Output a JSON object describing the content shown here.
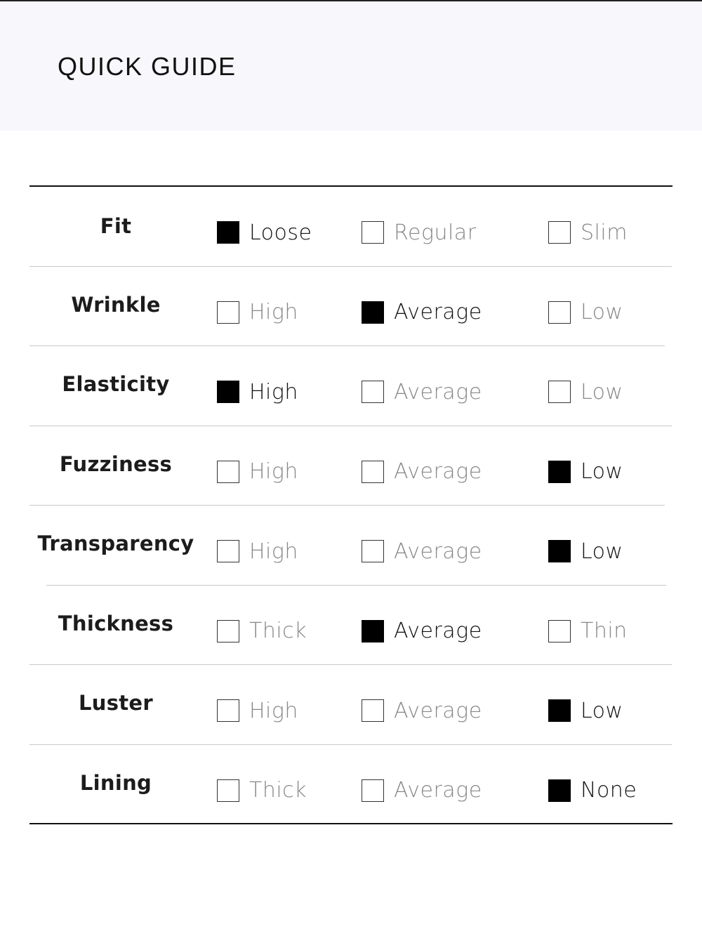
{
  "header": {
    "title": "QUICK GUIDE"
  },
  "guide": {
    "rows": [
      {
        "label": "Fit",
        "options": [
          {
            "text": "Loose",
            "selected": true
          },
          {
            "text": "Regular",
            "selected": false
          },
          {
            "text": "Slim",
            "selected": false
          }
        ]
      },
      {
        "label": "Wrinkle",
        "options": [
          {
            "text": "High",
            "selected": false
          },
          {
            "text": "Average",
            "selected": true
          },
          {
            "text": "Low",
            "selected": false
          }
        ]
      },
      {
        "label": "Elasticity",
        "options": [
          {
            "text": "High",
            "selected": true
          },
          {
            "text": "Average",
            "selected": false
          },
          {
            "text": "Low",
            "selected": false
          }
        ]
      },
      {
        "label": "Fuzziness",
        "options": [
          {
            "text": "High",
            "selected": false
          },
          {
            "text": "Average",
            "selected": false
          },
          {
            "text": "Low",
            "selected": true
          }
        ]
      },
      {
        "label": "Transparency",
        "options": [
          {
            "text": "High",
            "selected": false
          },
          {
            "text": "Average",
            "selected": false
          },
          {
            "text": "Low",
            "selected": true
          }
        ]
      },
      {
        "label": "Thickness",
        "options": [
          {
            "text": "Thick",
            "selected": false
          },
          {
            "text": "Average",
            "selected": true
          },
          {
            "text": "Thin",
            "selected": false
          }
        ]
      },
      {
        "label": "Luster",
        "options": [
          {
            "text": "High",
            "selected": false
          },
          {
            "text": "Average",
            "selected": false
          },
          {
            "text": "Low",
            "selected": true
          }
        ]
      },
      {
        "label": "Lining",
        "options": [
          {
            "text": "Thick",
            "selected": false
          },
          {
            "text": "Average",
            "selected": false
          },
          {
            "text": "None",
            "selected": true
          }
        ]
      }
    ]
  }
}
